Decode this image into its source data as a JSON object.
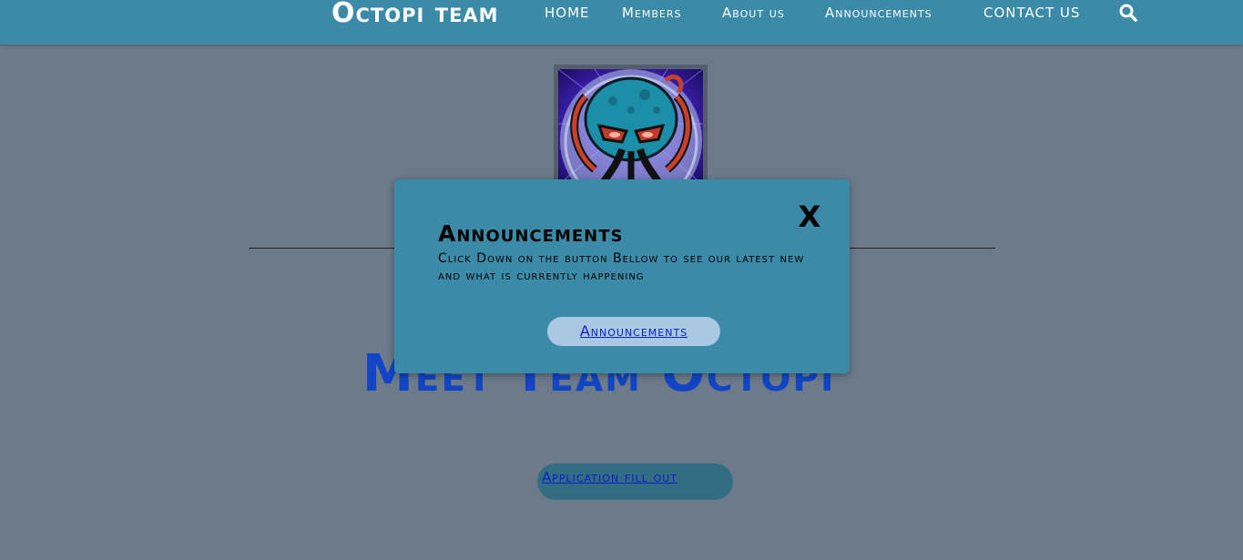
{
  "header": {
    "brand": "Octopi team",
    "nav": [
      {
        "label": "HOME"
      },
      {
        "label": "Members"
      },
      {
        "label": "About us"
      },
      {
        "label": "Announcements"
      },
      {
        "label": "CONTACT US"
      }
    ],
    "search_icon": "search-icon"
  },
  "main": {
    "logo_icon": "octopus-logo",
    "title": "Meet Team Octopi",
    "application_button": "Application fill out"
  },
  "modal": {
    "close_label": "X",
    "title": "Announcements",
    "body": "Click Down on the button Bellow to see our latest new and what is currently happening",
    "button_label": "Announcements"
  },
  "colors": {
    "navbar": "#3b8aa8",
    "page_background": "#6c7a89",
    "title": "#1145c5",
    "link": "#0c1ec8",
    "modal_background": "#3b8aa8",
    "modal_button": "#a9c8e1"
  }
}
